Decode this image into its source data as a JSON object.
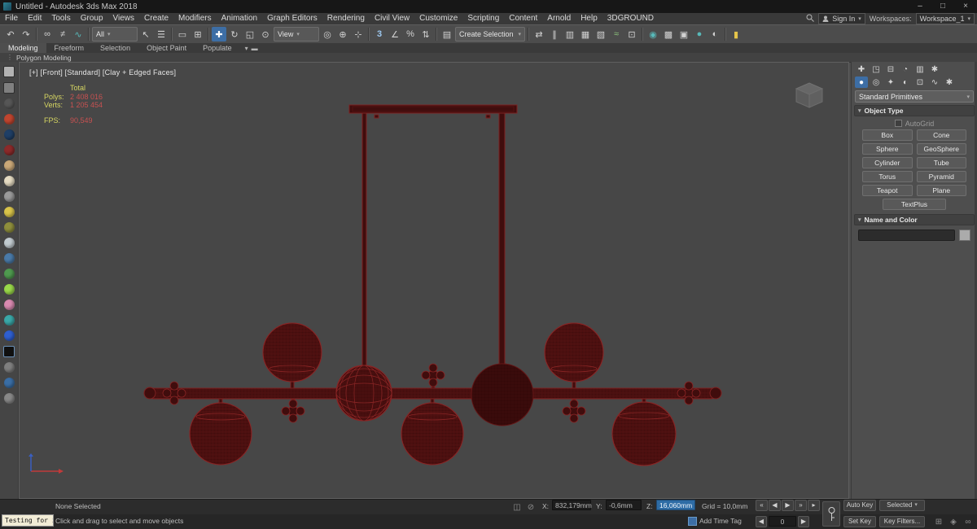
{
  "title_bar": {
    "title": "Untitled - Autodesk 3ds Max 2018"
  },
  "menu_bar": {
    "items": [
      "File",
      "Edit",
      "Tools",
      "Group",
      "Views",
      "Create",
      "Modifiers",
      "Animation",
      "Graph Editors",
      "Rendering",
      "Civil View",
      "Customize",
      "Scripting",
      "Content",
      "Arnold",
      "Help",
      "3DGROUND"
    ],
    "sign_in": "Sign In",
    "workspaces_label": "Workspaces:",
    "workspace_value": "Workspace_1"
  },
  "toolbar": {
    "selection_filter": "All",
    "ref_coord": "View",
    "named_selection": "Create Selection Se"
  },
  "ribbon": {
    "tabs": [
      "Modeling",
      "Freeform",
      "Selection",
      "Object Paint",
      "Populate"
    ],
    "subtab": "Polygon Modeling"
  },
  "viewport": {
    "label": "[+] [Front] [Standard] [Clay + Edged Faces]",
    "stats_total": "Total",
    "polys_label": "Polys:",
    "polys_value": "2 408 016",
    "verts_label": "Verts:",
    "verts_value": "1 205 454",
    "fps_label": "FPS:",
    "fps_value": "90,549"
  },
  "command_panel": {
    "dropdown_value": "Standard Primitives",
    "object_type_title": "Object Type",
    "autogrid_label": "AutoGrid",
    "buttons": [
      "Box",
      "Cone",
      "Sphere",
      "GeoSphere",
      "Cylinder",
      "Tube",
      "Torus",
      "Pyramid",
      "Teapot",
      "Plane",
      "TextPlus"
    ],
    "name_color_title": "Name and Color",
    "name_value": ""
  },
  "status_bar": {
    "selection_status": "None Selected",
    "prompt": "Click and drag to select and move objects",
    "tooltip": "Testing for i",
    "x_label": "X:",
    "x_value": "832,179mm",
    "y_label": "Y:",
    "y_value": "-0,6mm",
    "z_label": "Z:",
    "z_value": "16,060mm",
    "grid_label": "Grid = 10,0mm",
    "add_time_tag": "Add Time Tag",
    "auto_key": "Auto Key",
    "set_key": "Set Key",
    "selected_dropdown": "Selected",
    "key_filters": "Key Filters...",
    "frame_value": "0"
  },
  "colors": {
    "accent_blue": "#3d6ea5",
    "model_red": "#7e2121",
    "stat_yellow": "#d6d662",
    "stat_red": "#c65151"
  },
  "icons": {
    "chevron_down": "▾",
    "win_min": "–",
    "win_max": "□",
    "win_close": "×",
    "undo": "↶",
    "redo": "↷",
    "link": "∞",
    "unlink": "≠",
    "bind": "∿",
    "select_object": "↖",
    "select_by_name": "☰",
    "region": "▭",
    "crossing": "⊞",
    "move": "✚",
    "rotate": "↻",
    "scale": "◱",
    "place": "⊙",
    "pivot": "◎",
    "center": "⊕",
    "manipulate": "⊹",
    "snap3": "3",
    "angle_snap": "∠",
    "percent_snap": "%",
    "spinner_snap": "⇅",
    "named_sel": "▤",
    "mirror": "⇄",
    "align": "∥",
    "scene_explorer": "▥",
    "layer_explorer": "▦",
    "ribbon_toggle": "▧",
    "curve_editor": "≈",
    "schematic": "⊡",
    "material_editor": "◉",
    "render_setup": "▩",
    "rendered_frame": "▣",
    "render": "●",
    "render_iter": "◐",
    "custom_yellow": "▮",
    "cp_create": "✚",
    "cp_modify": "◳",
    "cp_hierarchy": "⊟",
    "cp_motion": "◔",
    "cp_display": "▥",
    "cp_utilities": "✱",
    "cat_geometry": "●",
    "cat_shapes": "◎",
    "cat_lights": "✦",
    "cat_cameras": "◐",
    "cat_helpers": "⊡",
    "cat_spacewarps": "∿",
    "cat_systems": "✱",
    "isolate": "◫",
    "lock": "⊘",
    "play_start": "«",
    "play_prev": "◀",
    "play": "▶",
    "play_next": "»",
    "play_end": "▸",
    "frame_prev": "◀",
    "frame_next": "▶",
    "grip": "⋮",
    "ribbon_min": "▬",
    "kbd_override": "⊞",
    "adaptive": "◈",
    "progressive": "∞"
  }
}
